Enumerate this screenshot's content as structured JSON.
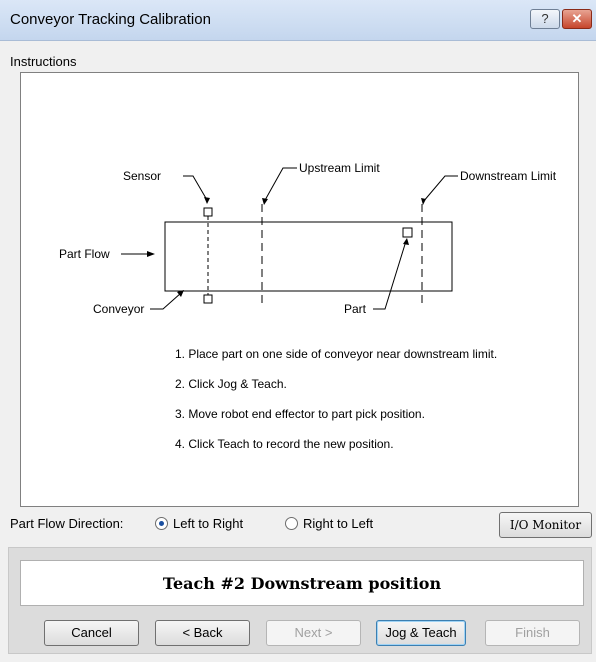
{
  "window": {
    "title": "Conveyor Tracking Calibration",
    "help_glyph": "?",
    "close_glyph": "✕"
  },
  "instructions_group": {
    "label": "Instructions"
  },
  "diagram": {
    "sensor": "Sensor",
    "upstream_limit": "Upstream Limit",
    "downstream_limit": "Downstream Limit",
    "part_flow": "Part Flow",
    "conveyor": "Conveyor",
    "part": "Part"
  },
  "steps": [
    "1. Place part on one side of conveyor near downstream limit.",
    "2. Click Jog & Teach.",
    "3. Move robot end effector to part pick position.",
    "4. Click Teach to record the new position."
  ],
  "part_flow_direction": {
    "label": "Part Flow Direction:",
    "options": [
      {
        "label": "Left to Right",
        "selected": true
      },
      {
        "label": "Right to Left",
        "selected": false
      }
    ]
  },
  "io_monitor_label": "I/O Monitor",
  "status_text": "Teach #2 Downstream position",
  "buttons": {
    "cancel": "Cancel",
    "back": "< Back",
    "next": "Next >",
    "jog_teach": "Jog & Teach",
    "finish": "Finish"
  }
}
